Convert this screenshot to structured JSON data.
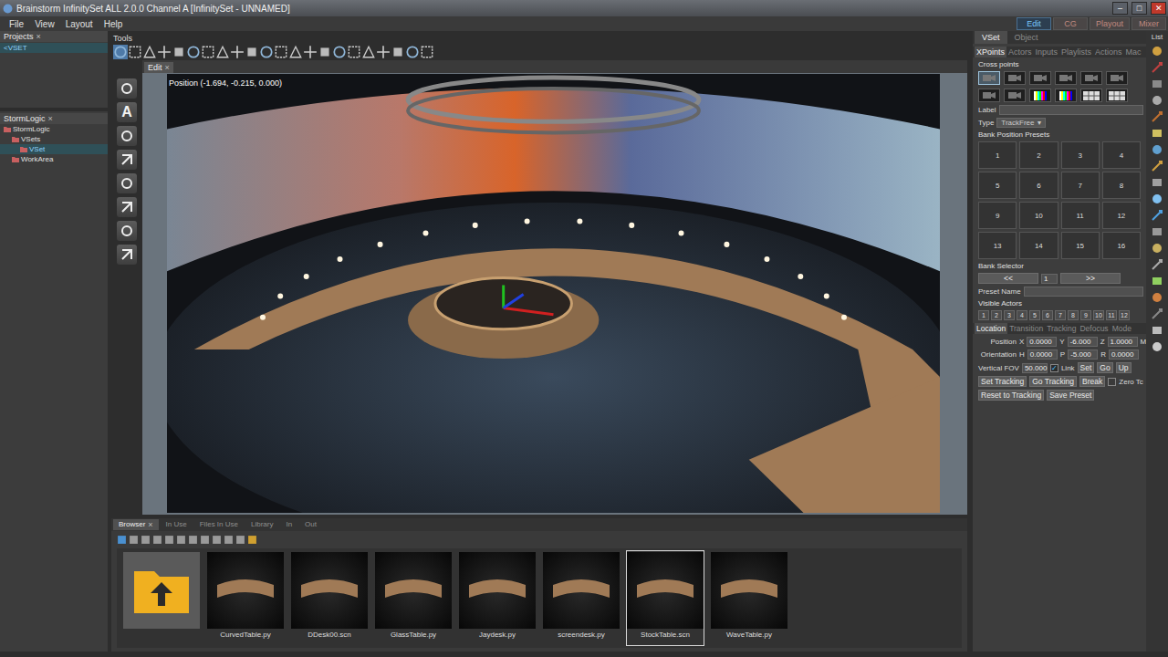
{
  "window": {
    "title": "Brainstorm InfinitySet ALL 2.0.0  Channel A [InfinitySet - UNNAMED]",
    "controls": [
      "–",
      "□",
      "✕"
    ]
  },
  "menu": [
    "File",
    "View",
    "Layout",
    "Help"
  ],
  "mode_tabs": [
    {
      "label": "Edit",
      "selected": true
    },
    {
      "label": "CG",
      "selected": false
    },
    {
      "label": "Playout",
      "selected": false
    },
    {
      "label": "Mixer",
      "selected": false
    }
  ],
  "projects": {
    "title": "Projects",
    "close": "×",
    "items": [
      {
        "label": "<VSET",
        "selected": true
      }
    ]
  },
  "tree": {
    "title": "StormLogic",
    "close": "×",
    "items": [
      {
        "label": "StormLogic",
        "depth": 0,
        "selected": false
      },
      {
        "label": "VSets",
        "depth": 1,
        "selected": false
      },
      {
        "label": "VSet",
        "depth": 2,
        "selected": true
      },
      {
        "label": "WorkArea",
        "depth": 1,
        "selected": false
      }
    ]
  },
  "tools": {
    "title": "Tools",
    "text_tool": "A"
  },
  "viewport": {
    "tab": "Edit",
    "close": "×",
    "overlay": "Position (-1.694, -0.215, 0.000)"
  },
  "browser": {
    "tabs": [
      {
        "label": "Browser",
        "selected": true,
        "close": "×"
      },
      {
        "label": "In Use",
        "selected": false,
        "close": ""
      },
      {
        "label": "Files In Use",
        "selected": false,
        "close": ""
      },
      {
        "label": "Library",
        "selected": false,
        "close": ""
      },
      {
        "label": "In",
        "selected": false,
        "close": ""
      },
      {
        "label": "Out",
        "selected": false,
        "close": ""
      }
    ],
    "items": [
      {
        "label": "",
        "kind": "folder",
        "selected": false
      },
      {
        "label": "CurvedTable.py",
        "kind": "model",
        "selected": false
      },
      {
        "label": "DDesk00.scn",
        "kind": "model",
        "selected": false
      },
      {
        "label": "GlassTable.py",
        "kind": "model",
        "selected": false
      },
      {
        "label": "Jaydesk.py",
        "kind": "model",
        "selected": false
      },
      {
        "label": "screendesk.py",
        "kind": "model",
        "selected": false
      },
      {
        "label": "StockTable.scn",
        "kind": "model",
        "selected": true
      },
      {
        "label": "WaveTable.py",
        "kind": "model",
        "selected": false
      }
    ]
  },
  "panel_tabs": [
    {
      "label": "VSet",
      "selected": true
    },
    {
      "label": "Object",
      "selected": false
    }
  ],
  "sub_tabs": [
    {
      "label": "XPoints",
      "selected": true
    },
    {
      "label": "Actors",
      "selected": false
    },
    {
      "label": "Inputs",
      "selected": false
    },
    {
      "label": "Playlists",
      "selected": false
    },
    {
      "label": "Actions",
      "selected": false
    },
    {
      "label": "Mac",
      "selected": false
    }
  ],
  "cross_points": {
    "title": "Cross points",
    "items": [
      {
        "kind": "camera",
        "selected": true
      },
      {
        "kind": "camera",
        "selected": false
      },
      {
        "kind": "camera",
        "selected": false
      },
      {
        "kind": "camera",
        "selected": false
      },
      {
        "kind": "camera",
        "selected": false
      },
      {
        "kind": "camera",
        "selected": false
      },
      {
        "kind": "camera",
        "selected": false
      },
      {
        "kind": "camera",
        "selected": false
      },
      {
        "kind": "bars",
        "selected": false
      },
      {
        "kind": "bars",
        "selected": false
      },
      {
        "kind": "grid",
        "selected": false
      },
      {
        "kind": "grid",
        "selected": false
      }
    ]
  },
  "label_field": {
    "label": "Label",
    "value": ""
  },
  "type_field": {
    "label": "Type",
    "value": "TrackFree",
    "arrow": "▾"
  },
  "presets": {
    "title": "Bank Position Presets",
    "buttons": [
      "1",
      "2",
      "3",
      "4",
      "5",
      "6",
      "7",
      "8",
      "9",
      "10",
      "11",
      "12",
      "13",
      "14",
      "15",
      "16"
    ]
  },
  "bank_selector": {
    "title": "Bank Selector",
    "prev": "<<",
    "value": "1",
    "next": ">>"
  },
  "preset_name": {
    "label": "Preset Name",
    "value": ""
  },
  "visible_actors": {
    "title": "Visible Actors",
    "items": [
      {
        "label": "1",
        "checked": false
      },
      {
        "label": "2",
        "checked": false
      },
      {
        "label": "3",
        "checked": false
      },
      {
        "label": "4",
        "checked": false
      },
      {
        "label": "5",
        "checked": false
      },
      {
        "label": "6",
        "checked": false
      },
      {
        "label": "7",
        "checked": false
      },
      {
        "label": "8",
        "checked": false
      },
      {
        "label": "9",
        "checked": false
      },
      {
        "label": "10",
        "checked": false
      },
      {
        "label": "11",
        "checked": false
      },
      {
        "label": "12",
        "checked": false
      }
    ]
  },
  "location_tabs": [
    {
      "label": "Location",
      "selected": true
    },
    {
      "label": "Transition",
      "selected": false
    },
    {
      "label": "Tracking",
      "selected": false
    },
    {
      "label": "Defocus",
      "selected": false
    },
    {
      "label": "Mode",
      "selected": false
    }
  ],
  "position": {
    "label": "Position",
    "fields": [
      {
        "label": "X",
        "value": "0.0000"
      },
      {
        "label": "Y",
        "value": "-6.000"
      },
      {
        "label": "Z",
        "value": "1.0000"
      }
    ],
    "unit": "M"
  },
  "orientation": {
    "label": "Orientation",
    "fields": [
      {
        "label": "H",
        "value": "0.0000"
      },
      {
        "label": "P",
        "value": "-5.000"
      },
      {
        "label": "R",
        "value": "0.0000"
      }
    ]
  },
  "fov": {
    "label": "Vertical FOV",
    "value": "50.000",
    "link": {
      "label": "Link",
      "checked": true,
      "mark": "✓"
    },
    "buttons": [
      "Set",
      "Go",
      "Up"
    ]
  },
  "tracking": {
    "buttons": [
      "Set Tracking",
      "Go Tracking",
      "Break"
    ],
    "zero": {
      "label": "Zero Tc",
      "checked": false
    }
  },
  "bottom_buttons": [
    "Reset to Tracking",
    "Save Preset"
  ],
  "side_strip": {
    "title": "List"
  }
}
